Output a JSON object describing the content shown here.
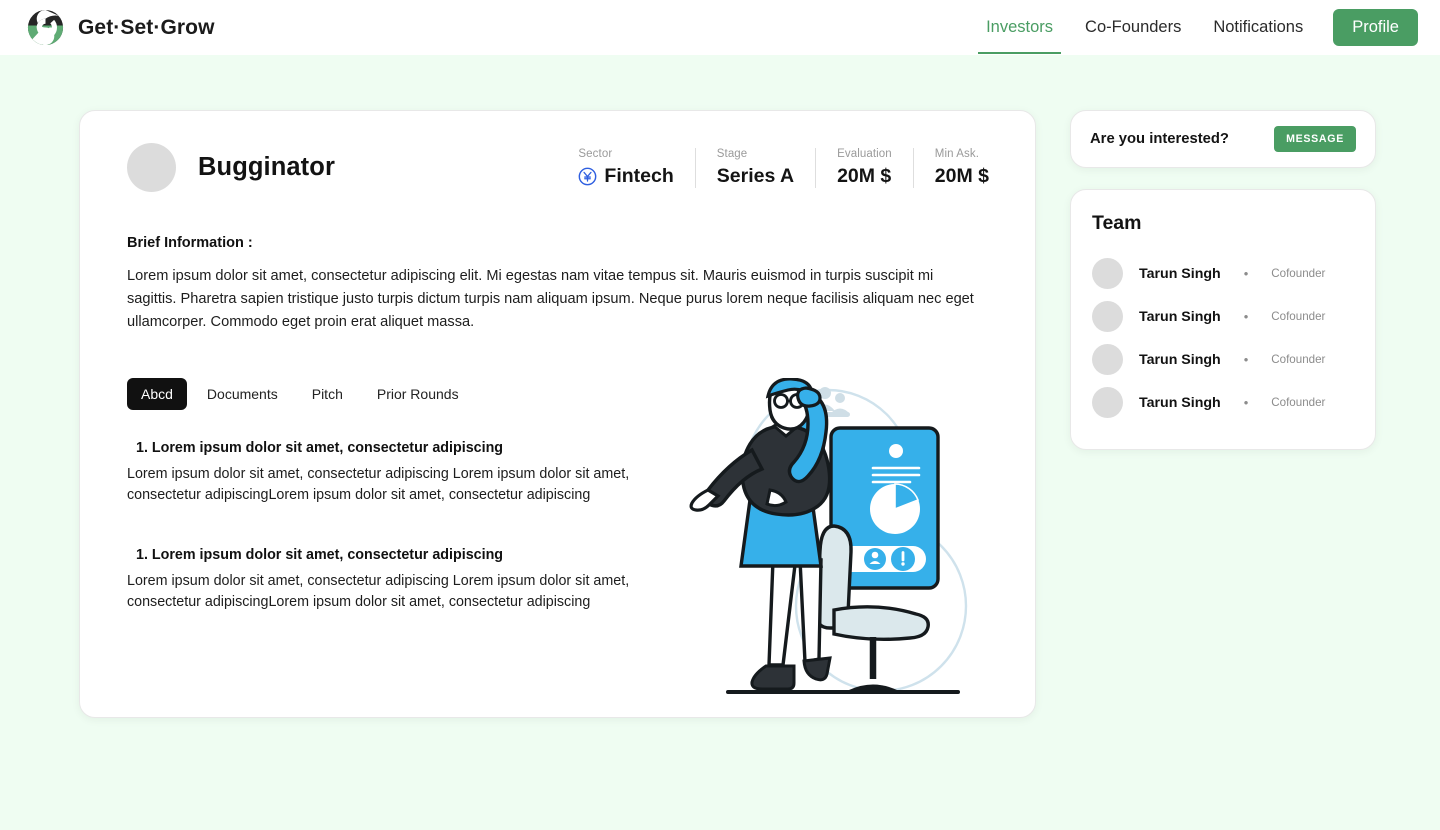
{
  "brand": {
    "name": "Get·Set·Grow",
    "logo_icon": "swirl-circle-logo",
    "colors": {
      "green": "#4a9d63",
      "dark": "#262626"
    }
  },
  "nav": {
    "items": [
      {
        "label": "Investors",
        "active": true
      },
      {
        "label": "Co-Founders",
        "active": false
      },
      {
        "label": "Notifications",
        "active": false
      }
    ],
    "profile_label": "Profile"
  },
  "company": {
    "name": "Bugginator",
    "avatar_icon": "company-avatar-placeholder",
    "stats": [
      {
        "label": "Sector",
        "value": "Fintech",
        "icon": "yen-circle-icon",
        "icon_color": "#2f5fe0"
      },
      {
        "label": "Stage",
        "value": "Series A",
        "icon": null
      },
      {
        "label": "Evaluation",
        "value": "20M $",
        "icon": null
      },
      {
        "label": "Min Ask.",
        "value": "20M $",
        "icon": null
      }
    ]
  },
  "brief": {
    "title": "Brief Information :",
    "body": "Lorem ipsum dolor sit amet, consectetur adipiscing elit. Mi egestas nam vitae tempus sit. Mauris euismod in turpis suscipit mi sagittis. Pharetra sapien tristique justo turpis dictum turpis nam aliquam ipsum. Neque purus lorem neque facilisis aliquam nec eget ullamcorper. Commodo eget proin erat aliquet massa."
  },
  "tabs": [
    {
      "label": "Abcd",
      "active": true
    },
    {
      "label": "Documents",
      "active": false
    },
    {
      "label": "Pitch",
      "active": false
    },
    {
      "label": "Prior Rounds",
      "active": false
    }
  ],
  "blocks": [
    {
      "heading": "1. Lorem ipsum dolor sit amet, consectetur adipiscing",
      "body": "Lorem ipsum dolor sit amet, consectetur adipiscing Lorem ipsum dolor sit amet, consectetur adipiscingLorem ipsum dolor sit amet, consectetur adipiscing"
    },
    {
      "heading": "1. Lorem ipsum dolor sit amet, consectetur adipiscing",
      "body": "Lorem ipsum dolor sit amet, consectetur adipiscing Lorem ipsum dolor sit amet, consectetur adipiscingLorem ipsum dolor sit amet, consectetur adipiscing"
    }
  ],
  "illustration": {
    "name": "woman-presenting-chart-illustration",
    "accent_color": "#36b0ea"
  },
  "interest": {
    "question": "Are you interested?",
    "button_label": "MESSAGE"
  },
  "team": {
    "title": "Team",
    "members": [
      {
        "name": "Tarun Singh",
        "separator": "•",
        "role": "Cofounder"
      },
      {
        "name": "Tarun Singh",
        "separator": "•",
        "role": "Cofounder"
      },
      {
        "name": "Tarun Singh",
        "separator": "•",
        "role": "Cofounder"
      },
      {
        "name": "Tarun Singh",
        "separator": "•",
        "role": "Cofounder"
      }
    ]
  }
}
